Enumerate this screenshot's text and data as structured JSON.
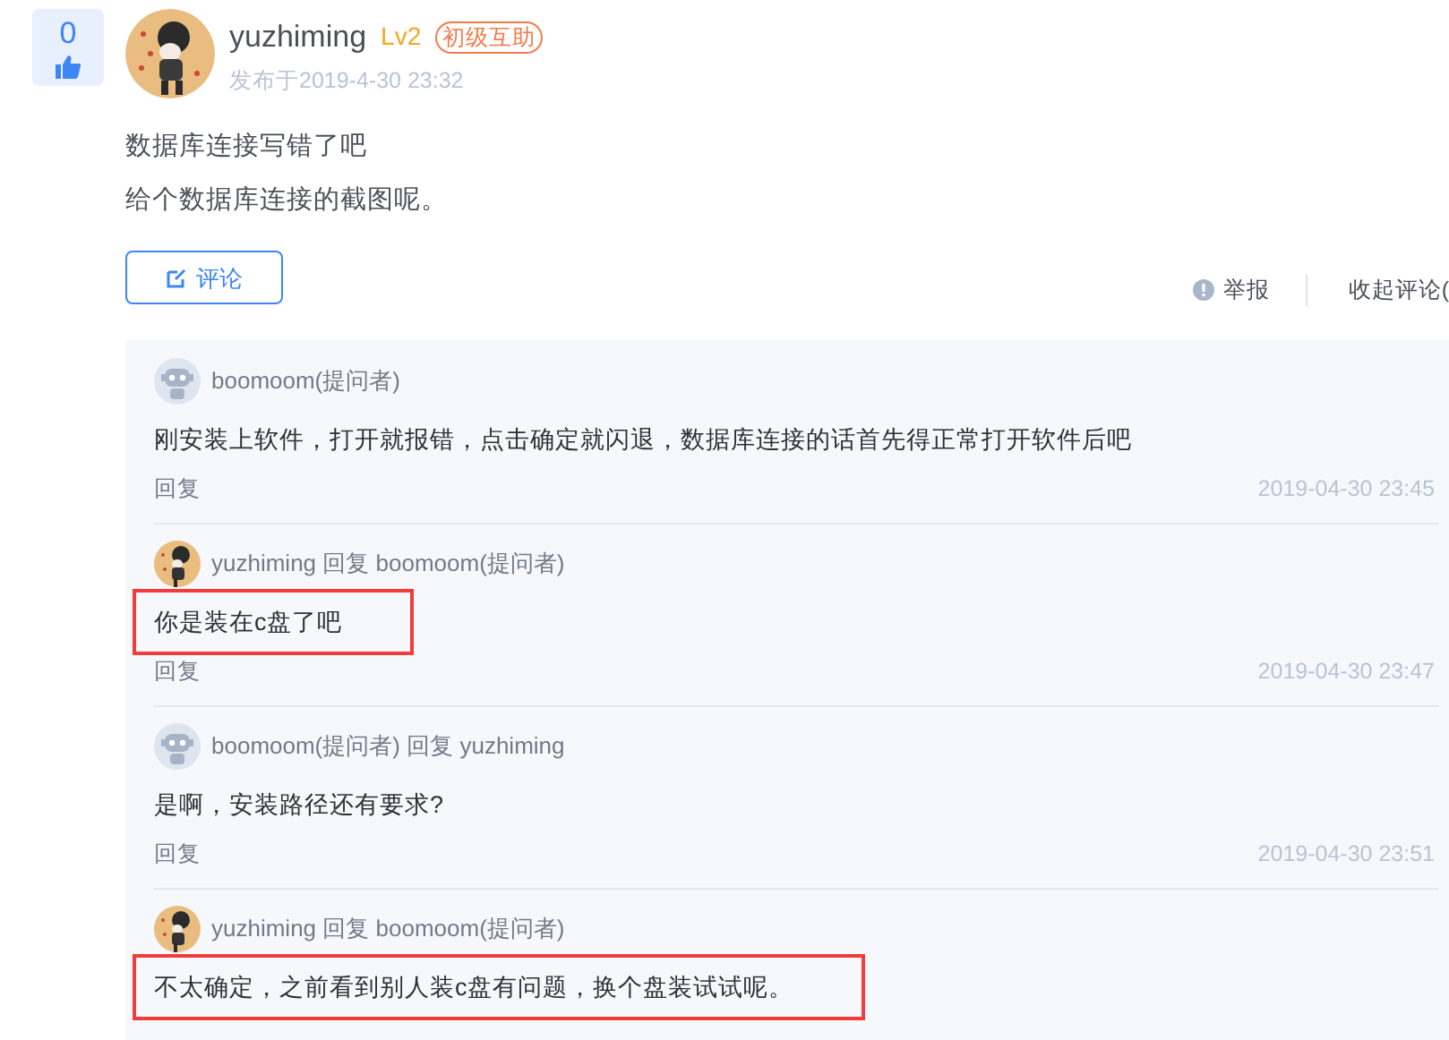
{
  "post": {
    "votes": "0",
    "author": "yuzhiming",
    "level": "Lv2",
    "badge": "初级互助",
    "published": "发布于2019-4-30 23:32",
    "paragraphs": [
      "数据库连接写错了吧",
      "给个数据库连接的截图呢。"
    ],
    "comment_button": "评论",
    "report": "举报",
    "collapse": "收起评论("
  },
  "comments": [
    {
      "kind": "robot",
      "author": "boomoom(提问者)",
      "text": "刚安装上软件，打开就报错，点击确定就闪退，数据库连接的话首先得正常打开软件后吧",
      "reply": "回复",
      "time": "2019-04-30 23:45",
      "annotated": false
    },
    {
      "kind": "picture",
      "author": "yuzhiming",
      "reply_word": "回复",
      "reply_to": "boomoom(提问者)",
      "text": "你是装在c盘了吧",
      "reply": "回复",
      "time": "2019-04-30 23:47",
      "annotated": true
    },
    {
      "kind": "robot",
      "author": "boomoom(提问者)",
      "reply_word": "回复",
      "reply_to": "yuzhiming",
      "text": "是啊，安装路径还有要求?",
      "reply": "回复",
      "time": "2019-04-30 23:51",
      "annotated": false
    },
    {
      "kind": "picture",
      "author": "yuzhiming",
      "reply_word": "回复",
      "reply_to": "boomoom(提问者)",
      "text": "不太确定，之前看到别人装c盘有问题，换个盘装试试呢。",
      "annotated": true
    }
  ]
}
